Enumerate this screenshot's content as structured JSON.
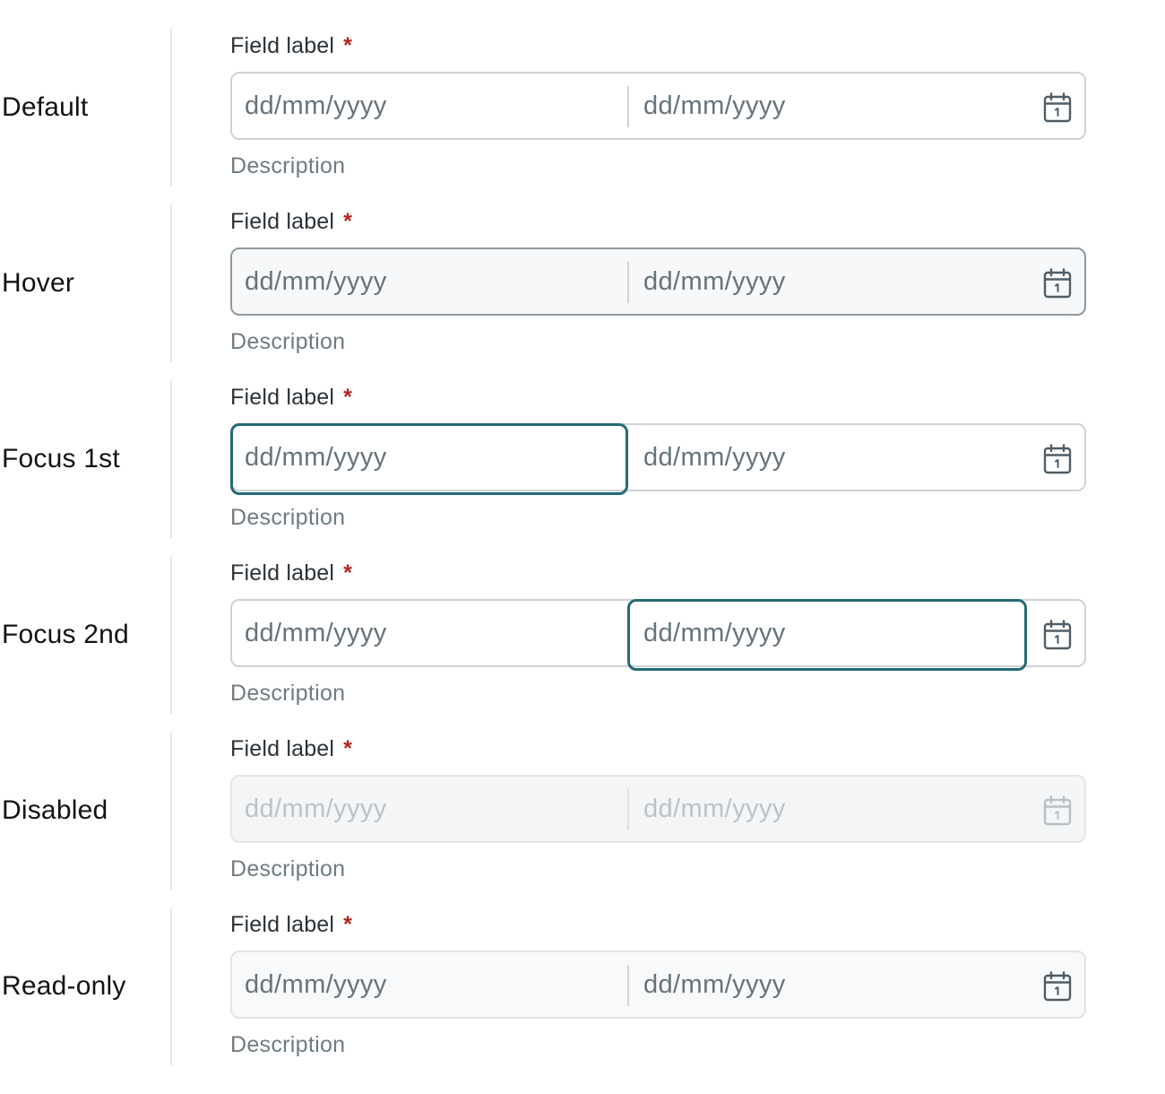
{
  "rows": [
    {
      "state": "Default",
      "label": "Field label",
      "required_mark": "*",
      "start_placeholder": "dd/mm/yyyy",
      "end_placeholder": "dd/mm/yyyy",
      "description": "Description"
    },
    {
      "state": "Hover",
      "label": "Field label",
      "required_mark": "*",
      "start_placeholder": "dd/mm/yyyy",
      "end_placeholder": "dd/mm/yyyy",
      "description": "Description"
    },
    {
      "state": "Focus 1st",
      "label": "Field label",
      "required_mark": "*",
      "start_placeholder": "dd/mm/yyyy",
      "end_placeholder": "dd/mm/yyyy",
      "description": "Description"
    },
    {
      "state": "Focus 2nd",
      "label": "Field label",
      "required_mark": "*",
      "start_placeholder": "dd/mm/yyyy",
      "end_placeholder": "dd/mm/yyyy",
      "description": "Description"
    },
    {
      "state": "Disabled",
      "label": "Field label",
      "required_mark": "*",
      "start_placeholder": "dd/mm/yyyy",
      "end_placeholder": "dd/mm/yyyy",
      "description": "Description"
    },
    {
      "state": "Read-only",
      "label": "Field label",
      "required_mark": "*",
      "start_placeholder": "dd/mm/yyyy",
      "end_placeholder": "dd/mm/yyyy",
      "description": "Description"
    }
  ],
  "icons": {
    "picker": "calendar-icon"
  },
  "colors": {
    "focus_border": "#246b73",
    "required": "#b3261e",
    "border_default": "#cdd3d6",
    "border_hover": "#8e999f",
    "placeholder": "#66737b"
  }
}
